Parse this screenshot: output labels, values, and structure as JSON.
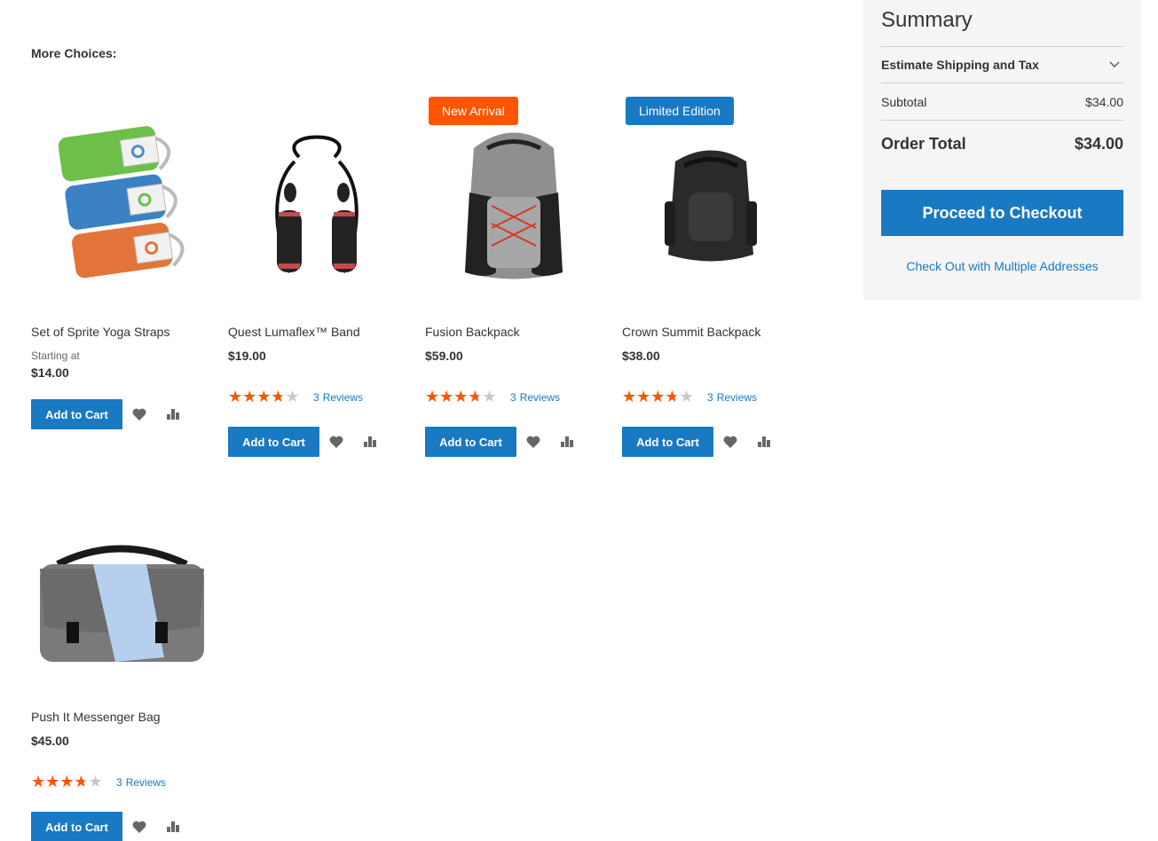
{
  "more_choices_label": "More Choices:",
  "products": [
    {
      "name": "Set of Sprite Yoga Straps",
      "starting_label": "Starting at",
      "price": "$14.00",
      "badge": "",
      "rating_percent": null,
      "review_count": "",
      "reviews_label": "",
      "add_to_cart": "Add to Cart",
      "icons": [
        "wishlist-icon",
        "compare-icon"
      ]
    },
    {
      "name": "Quest Lumaflex™ Band",
      "price": "$19.00",
      "badge": "",
      "rating_percent": 67,
      "review_count": "3",
      "reviews_label": "Reviews",
      "add_to_cart": "Add to Cart"
    },
    {
      "name": "Fusion Backpack",
      "price": "$59.00",
      "badge": "New Arrival",
      "rating_percent": 67,
      "review_count": "3",
      "reviews_label": "Reviews",
      "add_to_cart": "Add to Cart"
    },
    {
      "name": "Crown Summit Backpack",
      "price": "$38.00",
      "badge": "Limited Edition",
      "rating_percent": 67,
      "review_count": "3",
      "reviews_label": "Reviews",
      "add_to_cart": "Add to Cart"
    },
    {
      "name": "Push It Messenger Bag",
      "price": "$45.00",
      "badge": "",
      "rating_percent": 67,
      "review_count": "3",
      "reviews_label": "Reviews",
      "add_to_cart": "Add to Cart"
    }
  ],
  "colors": {
    "accent": "#1979c3",
    "badge_new": "#ff5501",
    "badge_limited": "#1979c3",
    "star": "#ff5501",
    "summary_bg": "#f5f5f5"
  },
  "summary": {
    "title": "Summary",
    "estimate_label": "Estimate Shipping and Tax",
    "subtotal_label": "Subtotal",
    "subtotal_value": "$34.00",
    "order_total_label": "Order Total",
    "order_total_value": "$34.00",
    "checkout_button": "Proceed to Checkout",
    "multi_address_link": "Check Out with Multiple Addresses"
  }
}
